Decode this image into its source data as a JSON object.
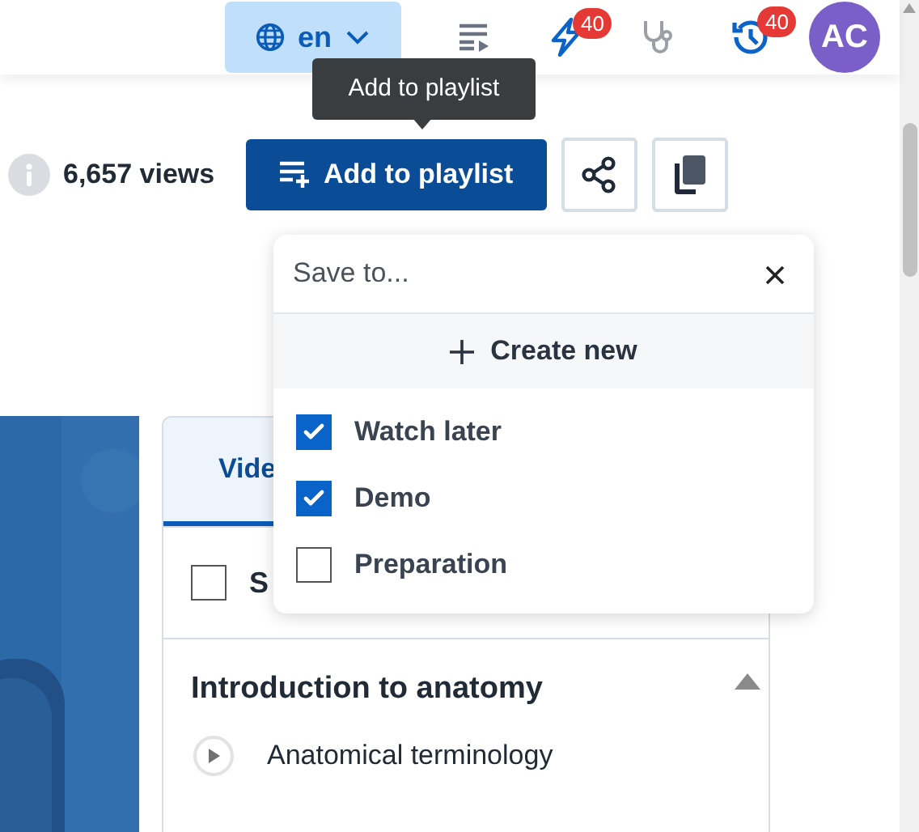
{
  "header": {
    "language": "en",
    "notifications_badge": "40",
    "history_badge": "40",
    "avatar": "AC"
  },
  "tooltip": "Add to playlist",
  "stats": {
    "views": "6,657 views"
  },
  "add_button": "Add to playlist",
  "panel": {
    "tabs": [
      {
        "label": "Vide",
        "selected": true
      }
    ],
    "select_label": "S",
    "select_checked": false,
    "section": "Introduction to anatomy",
    "lessons": [
      {
        "title": "Anatomical terminology"
      }
    ]
  },
  "save_popup": {
    "title": "Save to...",
    "create": "Create new",
    "playlists": [
      {
        "name": "Watch later",
        "checked": true
      },
      {
        "name": "Demo",
        "checked": true
      },
      {
        "name": "Preparation",
        "checked": false
      }
    ]
  }
}
